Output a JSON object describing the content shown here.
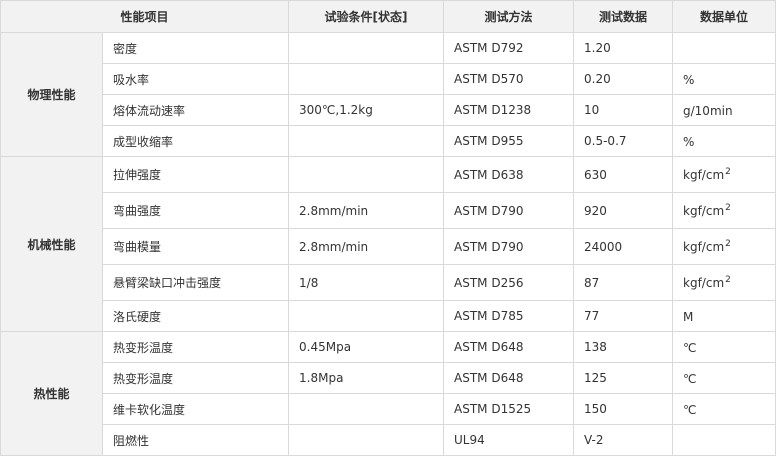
{
  "headers": {
    "item": "性能项目",
    "condition": "试验条件[状态]",
    "method": "测试方法",
    "value": "测试数据",
    "unit": "数据单位"
  },
  "groups": [
    {
      "name": "物理性能",
      "rows": [
        {
          "property": "密度",
          "condition": "",
          "method": "ASTM D792",
          "value": "1.20",
          "unit": "",
          "unit_sup": ""
        },
        {
          "property": "吸水率",
          "condition": "",
          "method": "ASTM D570",
          "value": "0.20",
          "unit": "%",
          "unit_sup": ""
        },
        {
          "property": "熔体流动速率",
          "condition": "300℃,1.2kg",
          "method": "ASTM D1238",
          "value": "10",
          "unit": "g/10min",
          "unit_sup": ""
        },
        {
          "property": "成型收缩率",
          "condition": "",
          "method": "ASTM D955",
          "value": "0.5-0.7",
          "unit": "%",
          "unit_sup": ""
        }
      ]
    },
    {
      "name": "机械性能",
      "rows": [
        {
          "property": "拉伸强度",
          "condition": "",
          "method": "ASTM D638",
          "value": "630",
          "unit": "kgf/cm",
          "unit_sup": "2"
        },
        {
          "property": "弯曲强度",
          "condition": "2.8mm/min",
          "method": "ASTM D790",
          "value": "920",
          "unit": "kgf/cm",
          "unit_sup": "2"
        },
        {
          "property": "弯曲模量",
          "condition": "2.8mm/min",
          "method": "ASTM D790",
          "value": "24000",
          "unit": "kgf/cm",
          "unit_sup": "2"
        },
        {
          "property": "悬臂梁缺口冲击强度",
          "condition": "1/8",
          "method": "ASTM D256",
          "value": "87",
          "unit": "kgf/cm",
          "unit_sup": "2"
        },
        {
          "property": "洛氏硬度",
          "condition": "",
          "method": "ASTM D785",
          "value": "77",
          "unit": "M",
          "unit_sup": ""
        }
      ]
    },
    {
      "name": "热性能",
      "rows": [
        {
          "property": "热变形温度",
          "condition": "0.45Mpa",
          "method": "ASTM D648",
          "value": "138",
          "unit": "℃",
          "unit_sup": ""
        },
        {
          "property": "热变形温度",
          "condition": "1.8Mpa",
          "method": "ASTM D648",
          "value": "125",
          "unit": "℃",
          "unit_sup": ""
        },
        {
          "property": "维卡软化温度",
          "condition": "",
          "method": "ASTM D1525",
          "value": "150",
          "unit": "℃",
          "unit_sup": ""
        },
        {
          "property": "阻燃性",
          "condition": "",
          "method": "UL94",
          "value": "V-2",
          "unit": "",
          "unit_sup": ""
        }
      ]
    }
  ]
}
